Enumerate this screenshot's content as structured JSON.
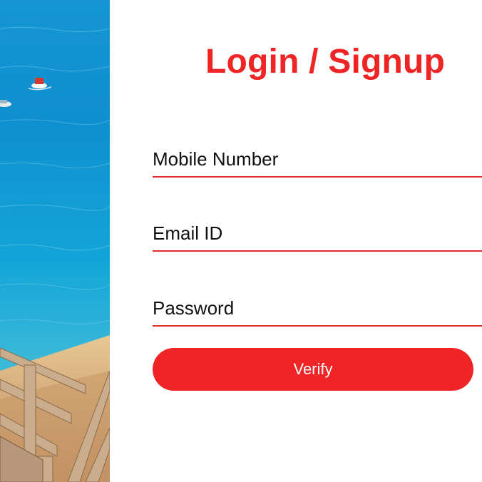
{
  "colors": {
    "accent": "#ee2524",
    "field_underline": "#e0302a",
    "button_text": "#ffffff",
    "text": "#111111"
  },
  "hero_image": {
    "subject": "beach-scene",
    "elements": [
      "sea",
      "boat-icon",
      "wooden-boardwalk"
    ]
  },
  "form": {
    "title": "Login / Signup",
    "mobile": {
      "placeholder": "Mobile Number",
      "value": ""
    },
    "email": {
      "placeholder": "Email ID",
      "value": ""
    },
    "password": {
      "placeholder": "Password",
      "value": ""
    },
    "verify_label": "Verify"
  }
}
